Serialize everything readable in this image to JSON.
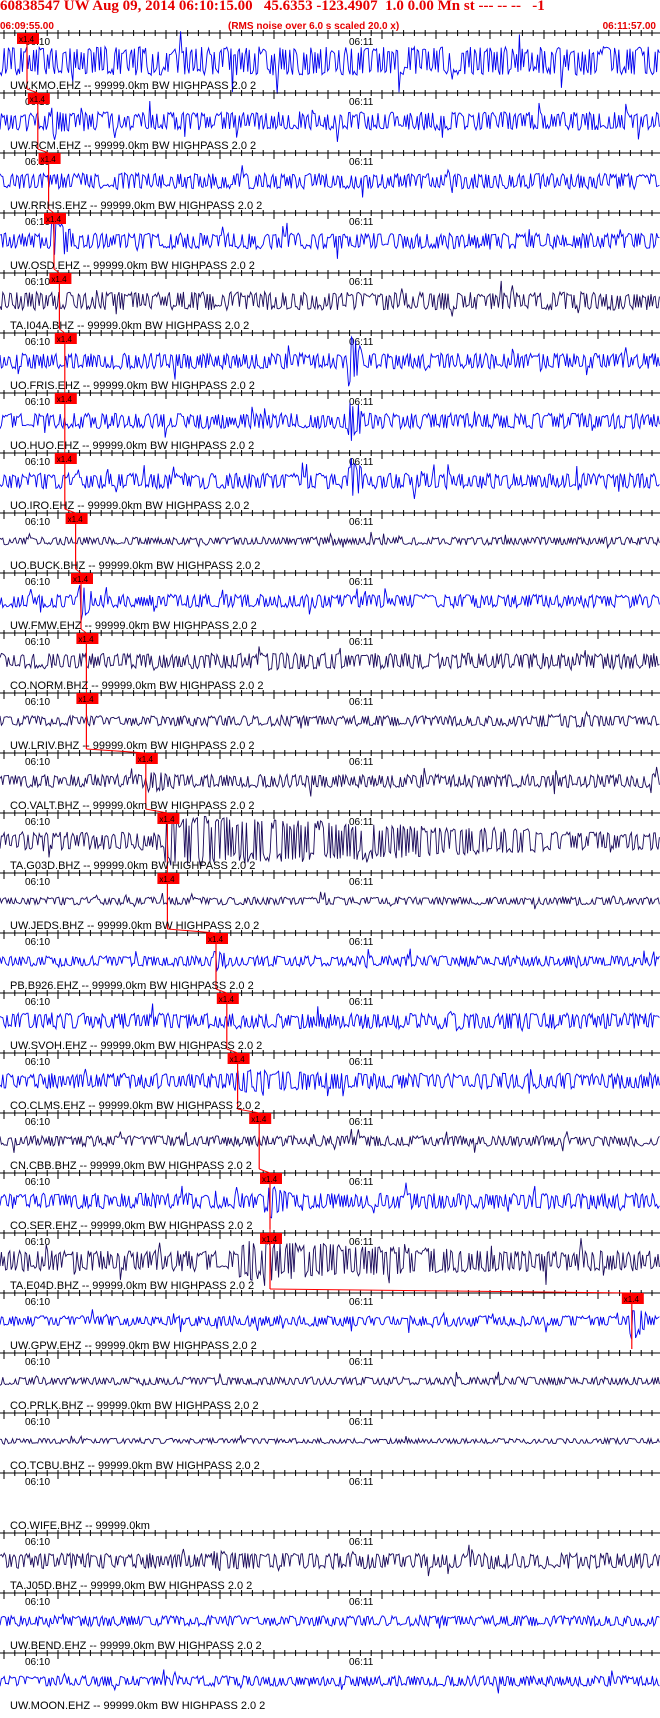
{
  "header": {
    "title": "60838547 UW Aug 09, 2014 06:10:15.00   45.6353 -123.4907  1.0 0.00 Mn st --- -- --   -1",
    "start_time": "06:09:55.00",
    "noise_note": "(RMS noise over 6.0 s scaled 20.0 x)",
    "end_time": "06:11:57.00"
  },
  "colors": {
    "trace_blue": "#0000ee",
    "trace_navy": "#1a0a5a",
    "pick": "#ff0000",
    "header": "#e60000"
  },
  "chart_data": {
    "type": "line",
    "title": "60838547 UW Aug 09, 2014 06:10:15.00   45.6353 -123.4907  1.0 0.00 Mn st --- -- --   -1",
    "x_range": [
      "06:09:55.00",
      "06:11:57.00"
    ],
    "x_tick_labels": [
      "06:10",
      "06:11"
    ],
    "pick_label": "x1.4",
    "series": [
      {
        "name": "UW.KMO.EHZ -- 99999.0km BW  HIGHPASS  2.0  2",
        "color": "blue",
        "pick_time": "06:10:00",
        "amplitude": 0.55,
        "event_time": "06:11:00",
        "event_amp": 0.6,
        "event_len": 12
      },
      {
        "name": "UW.RCM.EHZ -- 99999.0km BW  HIGHPASS  2.0  2",
        "color": "blue",
        "pick_time": "06:10:02",
        "amplitude": 0.35,
        "event_time": "06:10:05",
        "event_amp": 0.6,
        "event_len": 4
      },
      {
        "name": "UW.RRHS.EHZ -- 99999.0km BW  HIGHPASS  2.0  2",
        "color": "blue",
        "pick_time": "06:10:04",
        "amplitude": 0.3,
        "event_time": "06:10:17",
        "event_amp": 0.4,
        "event_len": 4
      },
      {
        "name": "UW.OSD.EHZ -- 99999.0km BW  HIGHPASS  2.0  2",
        "color": "blue",
        "pick_time": "06:10:05",
        "amplitude": 0.3,
        "event_time": "06:10:05",
        "event_amp": 0.95,
        "event_len": 3
      },
      {
        "name": "TA.I04A.BHZ -- 99999.0km BW  HIGHPASS  2.0  2",
        "color": "navy",
        "pick_time": "06:10:06",
        "amplitude": 0.35,
        "event_time": "",
        "event_amp": 0,
        "event_len": 0
      },
      {
        "name": "UO.FRIS.EHZ -- 99999.0km BW  HIGHPASS  2.0  2",
        "color": "blue",
        "pick_time": "06:10:07",
        "amplitude": 0.3,
        "event_time": "06:11:00",
        "event_amp": 1.0,
        "event_len": 2
      },
      {
        "name": "UO.HUO.EHZ -- 99999.0km BW  HIGHPASS  2.0  2",
        "color": "blue",
        "pick_time": "06:10:07",
        "amplitude": 0.3,
        "event_time": "06:11:00",
        "event_amp": 1.0,
        "event_len": 2
      },
      {
        "name": "UO.IRO.EHZ -- 99999.0km BW  HIGHPASS  2.0  2",
        "color": "blue",
        "pick_time": "06:10:07",
        "amplitude": 0.3,
        "event_time": "06:11:00",
        "event_amp": 1.0,
        "event_len": 2
      },
      {
        "name": "UO.BUCK.BHZ -- 99999.0km BW  HIGHPASS  2.0  2",
        "color": "navy",
        "pick_time": "06:10:09",
        "amplitude": 0.15,
        "event_time": "",
        "event_amp": 0,
        "event_len": 0
      },
      {
        "name": "UW.FMW.EHZ -- 99999.0km BW  HIGHPASS  2.0  2",
        "color": "blue",
        "pick_time": "06:10:10",
        "amplitude": 0.25,
        "event_time": "06:10:10",
        "event_amp": 0.8,
        "event_len": 2
      },
      {
        "name": "CO.NORM.BHZ -- 99999.0km BW  HIGHPASS  2.0  2",
        "color": "navy",
        "pick_time": "06:10:11",
        "amplitude": 0.3,
        "event_time": "06:10:45",
        "event_amp": 0.35,
        "event_len": 30
      },
      {
        "name": "UW.LRIV.BHZ -- 99999.0km BW  HIGHPASS  2.0  2",
        "color": "navy",
        "pick_time": "06:10:11",
        "amplitude": 0.2,
        "event_time": "06:11:35",
        "event_amp": 0.3,
        "event_len": 20
      },
      {
        "name": "CO.VALT.BHZ -- 99999.0km BW  HIGHPASS  2.0  2",
        "color": "navy",
        "pick_time": "06:10:22",
        "amplitude": 0.25,
        "event_time": "06:10:23",
        "event_amp": 0.45,
        "event_len": 6
      },
      {
        "name": "TA.G03D.BHZ -- 99999.0km BW  HIGHPASS  2.0  2",
        "color": "navy",
        "pick_time": "06:10:26",
        "amplitude": 0.35,
        "event_time": "06:10:26",
        "event_amp": 1.0,
        "event_len": 70
      },
      {
        "name": "UW.JEDS.BHZ -- 99999.0km BW  HIGHPASS  2.0  2",
        "color": "navy",
        "pick_time": "06:10:26",
        "amplitude": 0.15,
        "event_time": "",
        "event_amp": 0,
        "event_len": 0
      },
      {
        "name": "PB.B926.EHZ -- 99999.0km BW  HIGHPASS  2.0  2",
        "color": "blue",
        "pick_time": "06:10:35",
        "amplitude": 0.2,
        "event_time": "06:10:35",
        "event_amp": 0.5,
        "event_len": 2
      },
      {
        "name": "UW.SVOH.EHZ -- 99999.0km BW  HIGHPASS  2.0  2",
        "color": "blue",
        "pick_time": "06:10:37",
        "amplitude": 0.3,
        "event_time": "06:11:18",
        "event_amp": 0.45,
        "event_len": 5
      },
      {
        "name": "CO.CLMS.EHZ -- 99999.0km BW  HIGHPASS  2.0  2",
        "color": "blue",
        "pick_time": "06:10:39",
        "amplitude": 0.3,
        "event_time": "06:10:39",
        "event_amp": 0.45,
        "event_len": 30
      },
      {
        "name": "CN.CBB.BHZ -- 99999.0km BW  HIGHPASS  2.0  2",
        "color": "navy",
        "pick_time": "06:10:43",
        "amplitude": 0.2,
        "event_time": "",
        "event_amp": 0,
        "event_len": 0
      },
      {
        "name": "CO.SER.EHZ -- 99999.0km BW  HIGHPASS  2.0  2",
        "color": "blue",
        "pick_time": "06:10:45",
        "amplitude": 0.3,
        "event_time": "06:10:45",
        "event_amp": 0.7,
        "event_len": 4
      },
      {
        "name": "TA.E04D.BHZ -- 99999.0km BW  HIGHPASS  2.0  2",
        "color": "navy",
        "pick_time": "06:10:45",
        "amplitude": 0.4,
        "event_time": "06:10:40",
        "event_amp": 0.8,
        "event_len": 50
      },
      {
        "name": "UW.GPW.EHZ -- 99999.0km BW  HIGHPASS  2.0  2",
        "color": "blue",
        "pick_time": "06:11:52",
        "amplitude": 0.2,
        "event_time": "06:11:52",
        "event_amp": 0.8,
        "event_len": 3
      },
      {
        "name": "CO.PRLK.BHZ -- 99999.0km BW  HIGHPASS  2.0  2",
        "color": "navy",
        "pick_time": "",
        "amplitude": 0.15,
        "event_time": "",
        "event_amp": 0,
        "event_len": 0
      },
      {
        "name": "CO.TCBU.BHZ -- 99999.0km BW  HIGHPASS  2.0  2",
        "color": "navy",
        "pick_time": "",
        "amplitude": 0.1,
        "event_time": "",
        "event_amp": 0,
        "event_len": 0
      },
      {
        "name": "CO.WIFE.BHZ -- 99999.0km",
        "color": "none",
        "pick_time": "",
        "amplitude": 0,
        "event_time": "",
        "event_amp": 0,
        "event_len": 0
      },
      {
        "name": "TA.J05D.BHZ -- 99999.0km BW  HIGHPASS  2.0  2",
        "color": "navy",
        "pick_time": "",
        "amplitude": 0.3,
        "event_time": "06:10:35",
        "event_amp": 0.4,
        "event_len": 15
      },
      {
        "name": "UW.BEND.EHZ -- 99999.0km BW  HIGHPASS  2.0  2",
        "color": "blue",
        "pick_time": "",
        "amplitude": 0.2,
        "event_time": "",
        "event_amp": 0,
        "event_len": 0
      },
      {
        "name": "UW.MOON.EHZ -- 99999.0km BW  HIGHPASS  2.0  2",
        "color": "blue",
        "pick_time": "",
        "amplitude": 0.2,
        "event_time": "",
        "event_amp": 0,
        "event_len": 0
      }
    ]
  }
}
